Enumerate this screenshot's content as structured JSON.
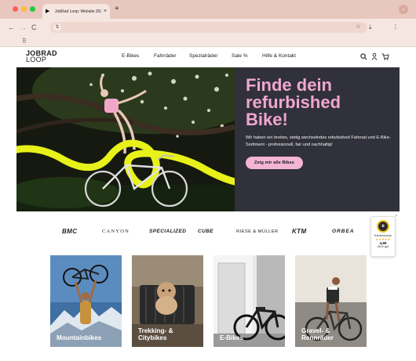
{
  "browser": {
    "tab_title": "JobRad Loop: Website 2025 ...",
    "tab_close": "×",
    "new_tab": "+",
    "nav_back": "←",
    "nav_forward": "→",
    "nav_reload": "C",
    "url_icon": "⇅",
    "star": "☆",
    "download": "⤓",
    "menu": "⋮",
    "tab_menu": "⌄",
    "apps": "⠿"
  },
  "header": {
    "logo_line1": "JOBRAD",
    "logo_line2": "LOOP",
    "nav": [
      "E-Bikes",
      "Fahrräder",
      "Spezialräder",
      "Sale %",
      "Hilfe & Kontakt"
    ],
    "icons": [
      "search-icon",
      "account-icon",
      "cart-icon"
    ]
  },
  "hero": {
    "headline_line1": "Finde dein",
    "headline_line2": "refurbished",
    "headline_line3": "Bike!",
    "subtext": "Wir haben ein breites, stetig wechselndes refurbished Fahrrad und E-Bike-Sortiment - professionell, fair und nachhaltig!",
    "cta": "Zeig mir alle Bikes"
  },
  "brands": [
    "BMC",
    "CANYON",
    "SPECIALIZED",
    "CUBE",
    "RIESE & MÜLLER",
    "KTM",
    "ORBEA"
  ],
  "trust_badge": {
    "seal": "e",
    "text": "Käuferschutz",
    "stars": "★★★★★",
    "score": "4,89",
    "label": "Sehr gut",
    "close": "×"
  },
  "categories": [
    {
      "line1": "Mountainbikes",
      "line2": ""
    },
    {
      "line1": "Trekking- &",
      "line2": "Citybikes"
    },
    {
      "line1": "E-Bikes",
      "line2": ""
    },
    {
      "line1": "Gravel- &",
      "line2": "Rennräder"
    }
  ],
  "colors": {
    "accent_pink": "#f0a7cf",
    "hero_bg": "#31313b",
    "chrome": "#e8c7bf",
    "highlight_yellow": "#e8f21a"
  }
}
